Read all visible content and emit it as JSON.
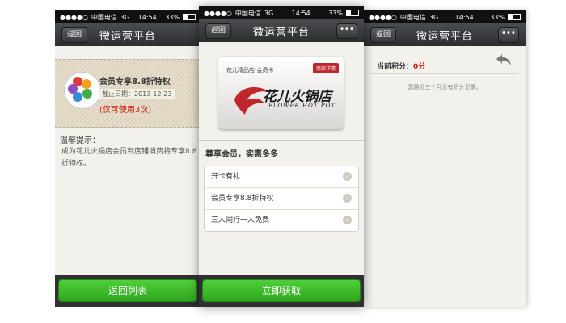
{
  "status": {
    "carrier": "中国电信",
    "network": "3G",
    "time": "14:54",
    "battery": "33%"
  },
  "nav": {
    "title": "微运营平台",
    "back_label": "返回",
    "more_label": "•••"
  },
  "phone1": {
    "coupon_title": "会员专享8.8折特权",
    "coupon_date": "截止日期：2013-12-23",
    "coupon_note": "(仅可使用3次)",
    "tips_heading": "温馨提示：",
    "tips_body": "成为花儿火锅店会员到店铺消费将专享8.8折特权。",
    "button_label": "返回列表"
  },
  "phone2": {
    "card_name": "花儿精品店-会员卡",
    "card_tag": "商家详情",
    "brand_cn": "花儿火锅店",
    "brand_en": "FLOWER HOT POT",
    "section_heading": "尊享会员，实惠多多",
    "items": [
      {
        "label": "开卡有礼"
      },
      {
        "label": "会员专享8.8折特权"
      },
      {
        "label": "三人同行一人免费"
      }
    ],
    "button_label": "立即获取"
  },
  "phone3": {
    "points_label": "当前积分：",
    "points_value": "0分",
    "empty_text": "您最近三个月没有积分记录。"
  },
  "colors": {
    "accent_green": "#34b326",
    "nav_dark": "#2b2d2f",
    "alert_red": "#c81f12"
  }
}
